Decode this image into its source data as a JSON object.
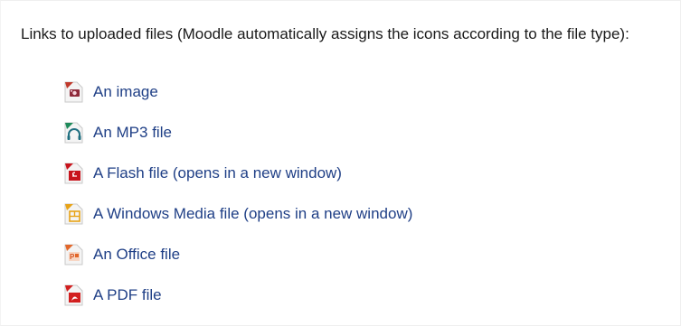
{
  "intro_text": "Links to uploaded files (Moodle automatically assigns the icons according to the file type):",
  "files": [
    {
      "label": "An image",
      "icon": "image-file-icon",
      "accent": "#c0392b"
    },
    {
      "label": "An MP3 file",
      "icon": "audio-file-icon",
      "accent": "#1f8a5a"
    },
    {
      "label": "A Flash file (opens in a new window)",
      "icon": "flash-file-icon",
      "accent": "#c8141c"
    },
    {
      "label": "A Windows Media file (opens in a new window)",
      "icon": "windows-media-file-icon",
      "accent": "#e8a317"
    },
    {
      "label": "An Office file",
      "icon": "office-file-icon",
      "accent": "#e2672a"
    },
    {
      "label": "A PDF file",
      "icon": "pdf-file-icon",
      "accent": "#d21f1f"
    }
  ],
  "colors": {
    "link": "#1f3f86",
    "text": "#1a1a1a",
    "background": "#ffffff"
  }
}
